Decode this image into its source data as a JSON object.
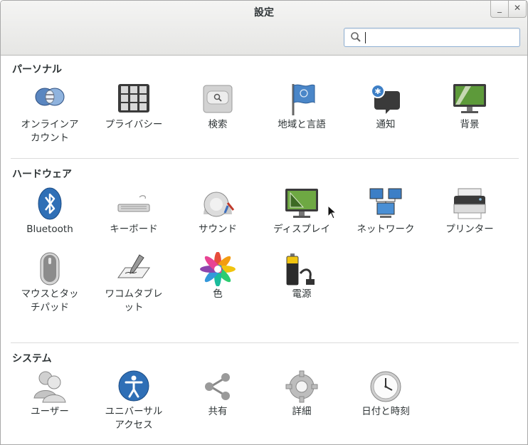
{
  "window": {
    "title": "設定"
  },
  "search": {
    "placeholder": "",
    "value": ""
  },
  "sections": {
    "personal": {
      "label": "パーソナル"
    },
    "hardware": {
      "label": "ハードウェア"
    },
    "system": {
      "label": "システム"
    }
  },
  "items": {
    "online_accounts": {
      "label": "オンラインア\nカウント",
      "icon": "online-accounts-icon"
    },
    "privacy": {
      "label": "プライバシー",
      "icon": "privacy-icon"
    },
    "search": {
      "label": "検索",
      "icon": "search-settings-icon"
    },
    "region": {
      "label": "地域と言語",
      "icon": "flag-icon"
    },
    "notifications": {
      "label": "通知",
      "icon": "notification-icon"
    },
    "background": {
      "label": "背景",
      "icon": "background-icon"
    },
    "bluetooth": {
      "label": "Bluetooth",
      "icon": "bluetooth-icon"
    },
    "keyboard": {
      "label": "キーボード",
      "icon": "keyboard-icon"
    },
    "sound": {
      "label": "サウンド",
      "icon": "sound-icon"
    },
    "display": {
      "label": "ディスプレイ",
      "icon": "display-icon"
    },
    "network": {
      "label": "ネットワーク",
      "icon": "network-icon"
    },
    "printers": {
      "label": "プリンター",
      "icon": "printer-icon"
    },
    "mouse": {
      "label": "マウスとタッ\nチパッド",
      "icon": "mouse-icon"
    },
    "wacom": {
      "label": "ワコムタブレ\nット",
      "icon": "tablet-icon"
    },
    "color": {
      "label": "色",
      "icon": "color-icon"
    },
    "power": {
      "label": "電源",
      "icon": "power-icon"
    },
    "users": {
      "label": "ユーザー",
      "icon": "users-icon"
    },
    "universal_access": {
      "label": "ユニバーサル\nアクセス",
      "icon": "universal-access-icon"
    },
    "sharing": {
      "label": "共有",
      "icon": "sharing-icon"
    },
    "details": {
      "label": "詳細",
      "icon": "gear-icon"
    },
    "datetime": {
      "label": "日付と時刻",
      "icon": "clock-icon"
    }
  },
  "colors": {
    "accent": "#3b78b8",
    "search_border": "#8fb0d4"
  }
}
